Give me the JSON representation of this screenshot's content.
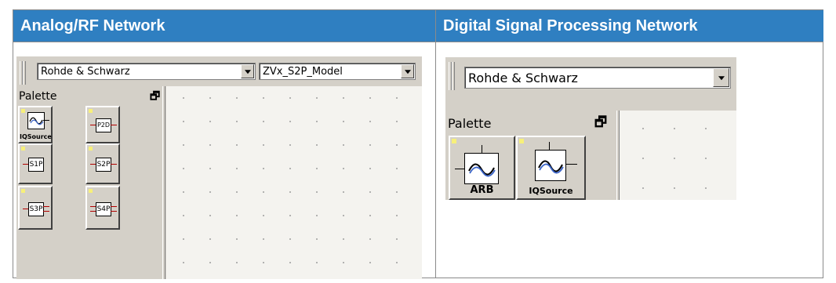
{
  "headers": {
    "left": "Analog/RF Network",
    "right": "Digital Signal Processing Network"
  },
  "left_panel": {
    "vendor_select": "Rohde & Schwarz",
    "model_select": "ZVx_S2P_Model",
    "palette_label": "Palette",
    "tiles": [
      {
        "icon": "iq-source-icon",
        "caption": "IQSource"
      },
      {
        "icon": "p2d-block-icon",
        "label": "P2D"
      },
      {
        "icon": "s1p-block-icon",
        "label": "S1P"
      },
      {
        "icon": "s2p-block-icon",
        "label": "S2P"
      },
      {
        "icon": "s3p-block-icon",
        "label": "S3P"
      },
      {
        "icon": "s4p-block-icon",
        "label": "S4P"
      }
    ]
  },
  "right_panel": {
    "vendor_select": "Rohde & Schwarz",
    "palette_label": "Palette",
    "tiles": [
      {
        "icon": "arb-source-icon",
        "caption": "ARB"
      },
      {
        "icon": "iq-source-icon",
        "caption": "IQSource"
      }
    ]
  },
  "colors": {
    "header_bg": "#2f7fc1",
    "header_text": "#ffffff",
    "panel_bg": "#d4d0c8",
    "pin_red": "#b00000",
    "source_dot": "#f7f07a"
  }
}
